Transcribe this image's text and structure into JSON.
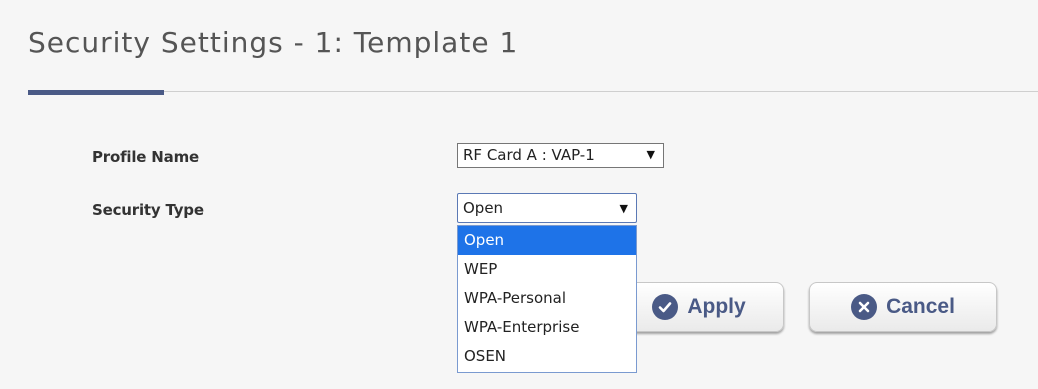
{
  "page": {
    "title": "Security Settings - 1: Template 1"
  },
  "form": {
    "profile_name": {
      "label": "Profile Name",
      "value": "RF Card A : VAP-1"
    },
    "security_type": {
      "label": "Security Type",
      "value": "Open",
      "options": [
        "Open",
        "WEP",
        "WPA-Personal",
        "WPA-Enterprise",
        "OSEN"
      ],
      "highlighted_option": "Open"
    }
  },
  "actions": {
    "apply_label": "Apply",
    "apply_icon": "check-circle-icon",
    "cancel_label": "Cancel",
    "cancel_icon": "x-circle-icon"
  },
  "colors": {
    "accent": "#4a5a86",
    "highlight": "#1e73e8",
    "panel_bg": "#f6f6f6"
  },
  "icons": {
    "dropdown_arrow": "▼"
  }
}
